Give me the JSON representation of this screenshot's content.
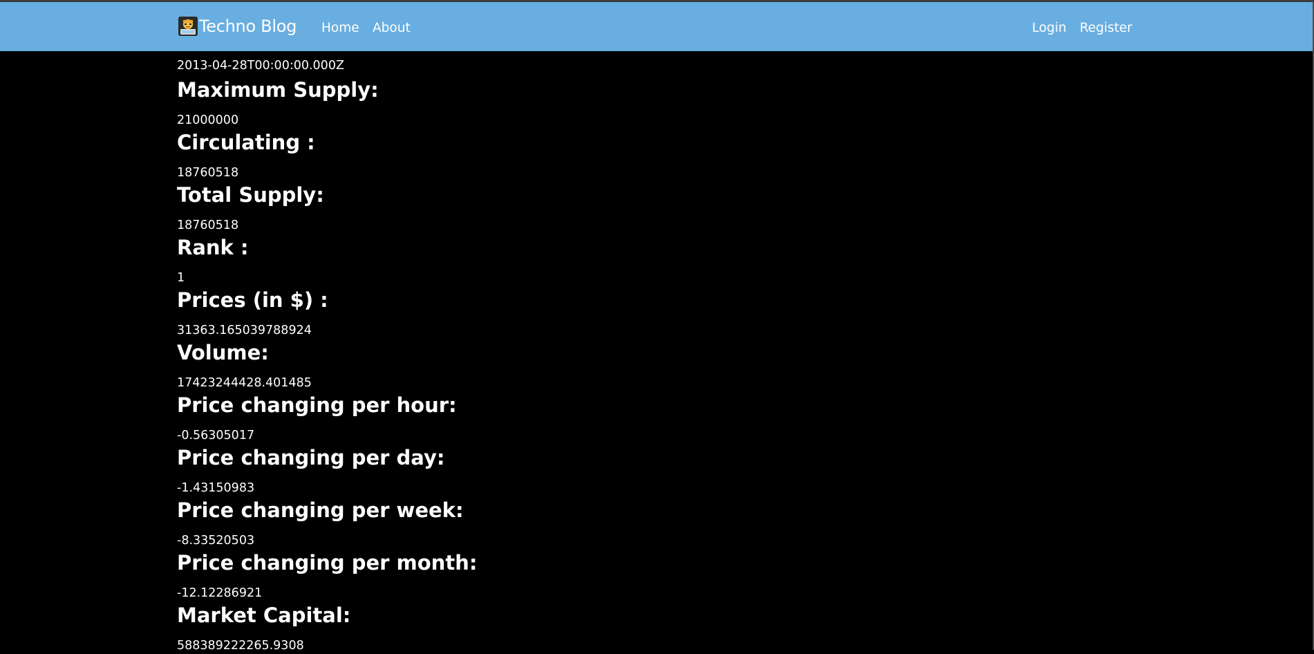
{
  "navbar": {
    "brand_name": "Techno Blog",
    "logo_icon": "blogger-avatar-icon",
    "links": {
      "home": "Home",
      "about": "About",
      "login": "Login",
      "register": "Register"
    },
    "background": "#68aee0"
  },
  "crypto": {
    "first_value": "2013-04-28T00:00:00.000Z",
    "fields": [
      {
        "label": "Maximum Supply:",
        "value": "21000000"
      },
      {
        "label": "Circulating :",
        "value": "18760518"
      },
      {
        "label": "Total Supply:",
        "value": "18760518"
      },
      {
        "label": "Rank :",
        "value": "1"
      },
      {
        "label": "Prices (in $) :",
        "value": "31363.165039788924"
      },
      {
        "label": "Volume:",
        "value": "17423244428.401485"
      },
      {
        "label": "Price changing per hour:",
        "value": "-0.56305017"
      },
      {
        "label": "Price changing per day:",
        "value": "-1.43150983"
      },
      {
        "label": "Price changing per week:",
        "value": "-8.33520503"
      },
      {
        "label": "Price changing per month:",
        "value": "-12.12286921"
      },
      {
        "label": "Market Capital:",
        "value": "588389222265.9308"
      }
    ]
  },
  "colors": {
    "page_background": "#000000",
    "text": "#ffffff"
  }
}
